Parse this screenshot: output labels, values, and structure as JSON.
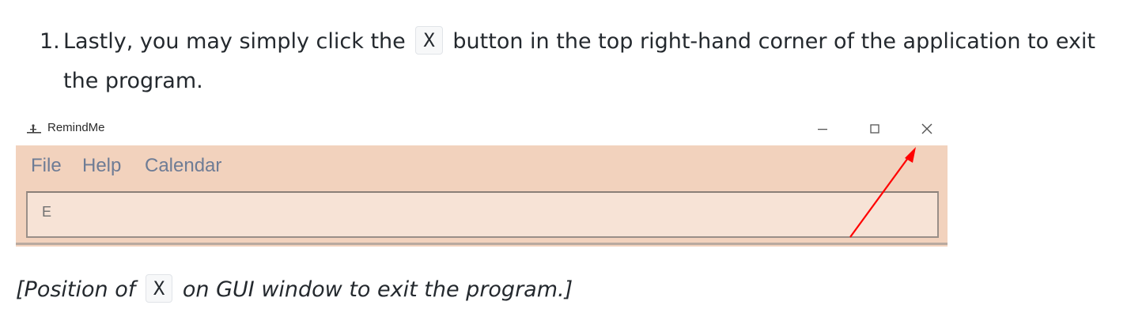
{
  "step": {
    "number": "1.",
    "text_before": "Lastly, you may simply click the",
    "key": "X",
    "text_after": "button in the top right-hand corner of the application to exit the program."
  },
  "window": {
    "title": "RemindMe",
    "controls": {
      "minimize": "—",
      "maximize": "☐",
      "close": "✕"
    },
    "menu": [
      "File",
      "Help",
      "Calendar"
    ],
    "input_value": "E"
  },
  "caption": {
    "before": "[Position of",
    "key": "X",
    "after": "on GUI window to exit the program.]"
  },
  "colors": {
    "menu_bg": "#f2d2bd",
    "input_bg": "#f7e3d6",
    "arrow": "#ff0000"
  },
  "icons": [
    "app-icon",
    "minimize-icon",
    "maximize-icon",
    "close-icon",
    "arrow-pointer"
  ]
}
